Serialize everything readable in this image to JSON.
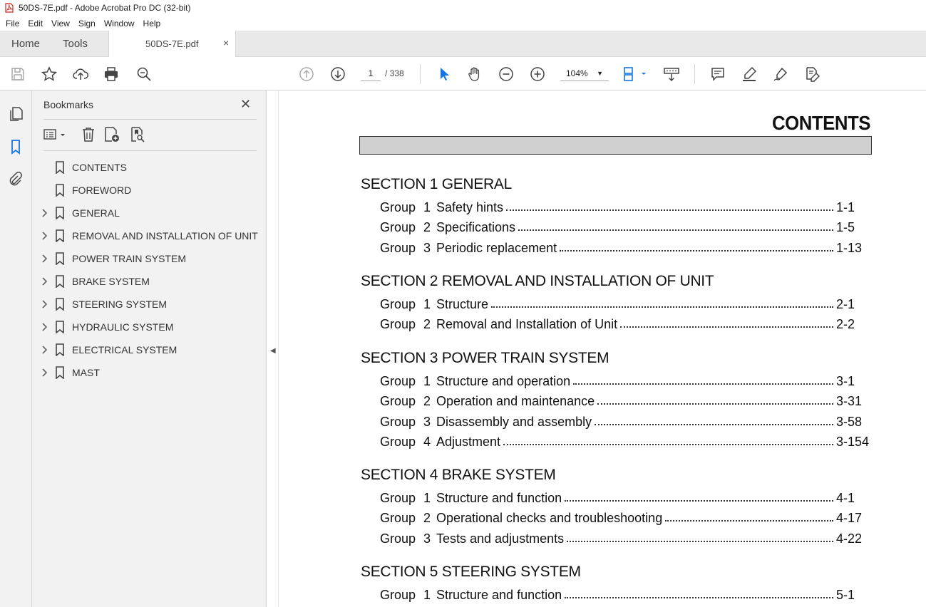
{
  "window": {
    "title": "50DS-7E.pdf - Adobe Acrobat Pro DC (32-bit)"
  },
  "menu": [
    "File",
    "Edit",
    "View",
    "Sign",
    "Window",
    "Help"
  ],
  "tabs": {
    "home": "Home",
    "tools": "Tools",
    "document": "50DS-7E.pdf",
    "close": "×"
  },
  "toolbar": {
    "page_current": "1",
    "page_total": "/ 338",
    "zoom": "104%"
  },
  "bookmarks_panel": {
    "title": "Bookmarks",
    "close": "✕",
    "items": [
      {
        "label": "CONTENTS",
        "expandable": false
      },
      {
        "label": "FOREWORD",
        "expandable": false
      },
      {
        "label": "GENERAL",
        "expandable": true
      },
      {
        "label": "REMOVAL AND INSTALLATION OF UNIT",
        "expandable": true
      },
      {
        "label": "POWER TRAIN SYSTEM",
        "expandable": true
      },
      {
        "label": "BRAKE SYSTEM",
        "expandable": true
      },
      {
        "label": "STEERING SYSTEM",
        "expandable": true
      },
      {
        "label": "HYDRAULIC SYSTEM",
        "expandable": true
      },
      {
        "label": "ELECTRICAL SYSTEM",
        "expandable": true
      },
      {
        "label": "MAST",
        "expandable": true
      }
    ]
  },
  "document": {
    "heading": "CONTENTS",
    "sections": [
      {
        "title": "SECTION 1  GENERAL",
        "groups": [
          {
            "label": "Group",
            "num": "1",
            "title": "Safety hints",
            "page": "1-1"
          },
          {
            "label": "Group",
            "num": "2",
            "title": "Specifications",
            "page": "1-5"
          },
          {
            "label": "Group",
            "num": "3",
            "title": "Periodic replacement",
            "page": "1-13"
          }
        ]
      },
      {
        "title": "SECTION 2  REMOVAL AND INSTALLATION OF UNIT",
        "groups": [
          {
            "label": "Group",
            "num": "1",
            "title": "Structure",
            "page": "2-1"
          },
          {
            "label": "Group",
            "num": "2",
            "title": "Removal and Installation of Unit",
            "page": "2-2"
          }
        ]
      },
      {
        "title": "SECTION 3  POWER TRAIN SYSTEM",
        "groups": [
          {
            "label": "Group",
            "num": "1",
            "title": "Structure and operation",
            "page": "3-1"
          },
          {
            "label": "Group",
            "num": "2",
            "title": "Operation and maintenance",
            "page": "3-31"
          },
          {
            "label": "Group",
            "num": "3",
            "title": "Disassembly and assembly",
            "page": "3-58"
          },
          {
            "label": "Group",
            "num": "4",
            "title": "Adjustment",
            "page": "3-154"
          }
        ]
      },
      {
        "title": "SECTION 4  BRAKE SYSTEM",
        "groups": [
          {
            "label": "Group",
            "num": "1",
            "title": "Structure and function",
            "page": "4-1"
          },
          {
            "label": "Group",
            "num": "2",
            "title": "Operational checks and troubleshooting",
            "page": "4-17"
          },
          {
            "label": "Group",
            "num": "3",
            "title": "Tests and adjustments",
            "page": "4-22"
          }
        ]
      },
      {
        "title": "SECTION 5  STEERING SYSTEM",
        "groups": [
          {
            "label": "Group",
            "num": "1",
            "title": "Structure and function",
            "page": "5-1"
          }
        ]
      }
    ]
  }
}
